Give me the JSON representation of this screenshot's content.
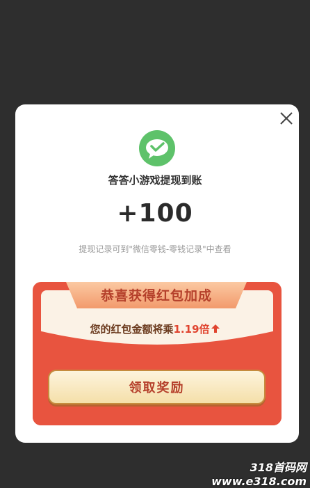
{
  "dialog": {
    "close_icon": "close-icon",
    "brand_icon": "wechat-pay-icon",
    "title": "答答小游戏提现到账",
    "amount": "+100",
    "note": "提现记录可到\"微信零钱-零钱记录\"中查看"
  },
  "bonus": {
    "ribbon_text": "恭喜获得红包加成",
    "multiplier_prefix": "您的红包金额将乘",
    "multiplier_value": "1.19倍",
    "arrow_icon": "arrow-up-icon",
    "claim_button_label": "领取奖励"
  },
  "watermark": "318首码网 www.e318.com",
  "colors": {
    "accent_red": "#e8543f",
    "gold": "#f5dfa9",
    "wechat_green": "#5ec26a"
  }
}
